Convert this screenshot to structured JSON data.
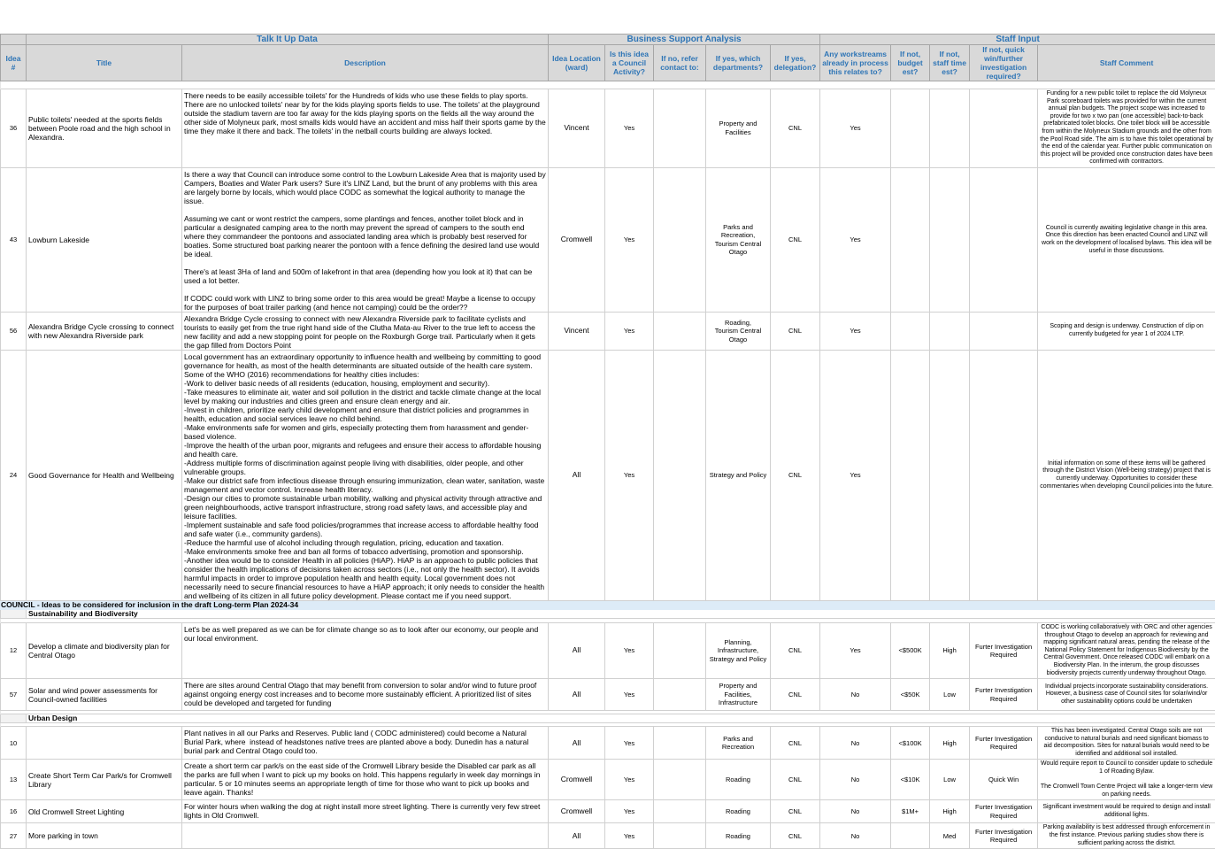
{
  "groups": {
    "talk": "Talk It Up Data",
    "business": "Business Support Analysis",
    "staff": "Staff Input"
  },
  "headers": {
    "idea": "Idea #",
    "title": "Title",
    "description": "Description",
    "location": "Idea Location (ward)",
    "council_activity": "Is this idea a Council Activity?",
    "refer": "If no, refer contact to:",
    "departments": "If yes, which departments?",
    "delegation": "If yes, delegation?",
    "workstreams": "Any workstreams already in process this relates to?",
    "budget": "If not, budget est?",
    "staff_time": "If not, staff time est?",
    "quick_win": "If not, quick win/further investigation required?",
    "comment": "Staff Comment"
  },
  "rows_a": [
    {
      "id": "36",
      "title": "Public toilets' needed at the sports fields between Poole road and the high school in Alexandra.",
      "desc": "There needs to be easily accessible toilets' for the Hundreds of kids who use these fields to play sports. There are no unlocked toilets' near by for the kids playing sports fields to use. The toilets' at the playground outside the stadium tavern are too far away for the kids playing sports on the fields all the way around the other side of Molyneux park, most smalls kids would have an accident and miss half their sports game by the time they make it there and back. The toilets' in the netball courts building are always locked.",
      "loc": "Vincent",
      "council": "Yes",
      "refer": "",
      "dept": "Property and Facilities",
      "deleg": "CNL",
      "work": "Yes",
      "budget": "",
      "time": "",
      "quick": "",
      "cmt": "Funding for a new public toilet to replace the old Molyneux Park scoreboard toilets was provided for within the current annual plan budgets. The project scope was increased to provide for two x two pan (one accessible) back-to-back prefabricated toilet blocks. One toilet block will be accessible from within the Molyneux Stadium grounds and the other from the Pool Road side. The aim is to have this toilet operational by the end of the calendar year. Further public communication on this project will be provided once construction dates have been confirmed with contractors."
    },
    {
      "id": "43",
      "title": "Lowburn Lakeside",
      "desc": "Is there a way that Council can introduce some control to the Lowburn Lakeside Area that is majority used by Campers, Boaties and Water Park users? Sure it's LINZ Land, but the brunt of any problems with this area are largely borne by locals, which would place CODC as somewhat the logical authority to manage the issue.\n\nAssuming we cant or wont restrict the campers, some plantings and fences, another toilet block and in particular a designated camping area to the north may prevent the spread of campers to the south end where they commandeer the pontoons and associated landing area which is probably best reserved for boaties. Some structured boat parking nearer the pontoon with a fence defining the desired land use would be ideal.\n\nThere's at least 3Ha of land and 500m of lakefront in that area (depending how you look at it) that can be used a lot better.\n\nIf CODC could work with LINZ to bring some order to this area would be great! Maybe a license to occupy for the purposes of boat trailer parking (and hence not camping) could be the order??",
      "loc": "Cromwell",
      "council": "Yes",
      "refer": "",
      "dept": "Parks and Recreation,\nTourism Central Otago",
      "deleg": "CNL",
      "work": "Yes",
      "budget": "",
      "time": "",
      "quick": "",
      "cmt": "Council is currently awaiting legislative change in this area. Once this direction has been enacted Council and LINZ will work on the development of localised bylaws. This idea will be useful in those discussions."
    },
    {
      "id": "56",
      "title": "Alexandra Bridge Cycle crossing to connect with new Alexandra Riverside park",
      "desc": "Alexandra Bridge Cycle crossing to connect with new Alexandra Riverside park to facilitate cyclists and tourists to easily get from the true right hand side of the Clutha Mata-au River to the true left to access the new facility and add a new stopping point for people on the Roxburgh Gorge trail. Particularly when it gets the gap filled from Doctors Point",
      "loc": "Vincent",
      "council": "Yes",
      "refer": "",
      "dept": "Roading,\nTourism Central Otago",
      "deleg": "CNL",
      "work": "Yes",
      "budget": "",
      "time": "",
      "quick": "",
      "cmt": "Scoping and design is underway. Construction of clip on currently budgeted for year 1 of 2024 LTP."
    },
    {
      "id": "24",
      "title": "Good Governance for Health and Wellbeing",
      "desc": "Local government has an extraordinary opportunity to influence health and wellbeing by committing to good governance for health, as most of the health determinants are situated outside of the health care system. Some of the WHO (2016) recommendations for healthy cities includes:\n-Work to deliver basic needs of all residents (education, housing, employment and security).\n-Take measures to eliminate air, water and soil pollution in the district and tackle climate change at the local level by making our industries and cities green and ensure clean energy and air.\n-Invest in children, prioritize early child development and ensure that district policies and programmes in health, education and social services leave no child behind.\n-Make environments safe for women and girls, especially protecting them from harassment and gender-based violence.\n-Improve the health of the urban poor, migrants and refugees and ensure their access to affordable housing and health care.\n-Address multiple forms of discrimination against people living with disabilities, older people, and other vulnerable groups.\n-Make our district safe from infectious disease through ensuring immunization, clean water, sanitation, waste management and vector control. Increase health literacy.\n-Design our cities to promote sustainable urban mobility, walking and physical activity through attractive and green neighbourhoods, active transport infrastructure, strong road safety laws, and accessible play and leisure facilities.\n-Implement sustainable and safe food policies/programmes that increase access to affordable healthy food and safe water (i.e., community gardens).\n-Reduce the harmful use of alcohol including through regulation, pricing, education and taxation.\n-Make environments smoke free and ban all forms of tobacco advertising, promotion and sponsorship.\n-Another idea would be to consider Health in all policies (HiAP). HiAP is an approach to public policies that consider the health implications of decisions taken across sectors (i.e., not only the health sector). It avoids harmful impacts in order to improve population health and health equity. Local government does not necessarily need to secure financial resources to have a HiAP approach; it only needs to consider the health and wellbeing of its citizen in all future policy development. Please contact me if you need support.",
      "loc": "All",
      "council": "Yes",
      "refer": "",
      "dept": "Strategy and Policy",
      "deleg": "CNL",
      "work": "Yes",
      "budget": "",
      "time": "",
      "quick": "",
      "cmt": "Initial information on some of these items will be gathered through the District Vision (Well-being strategy) project that is currently underway. Opportunities to consider these commentaries when developing Council policies into the future."
    }
  ],
  "section_title": "COUNCIL - Ideas to be considered for inclusion in the draft Long-term Plan 2024-34",
  "sub_sustainability": "Sustainability and Biodiversity",
  "rows_b": [
    {
      "id": "12",
      "title": "Develop a climate and biodiversity plan for Central Otago",
      "desc": "Let's be as well prepared as we can be for climate change so as to look after our economy, our people and our local environment.",
      "loc": "All",
      "council": "Yes",
      "refer": "",
      "dept": "Planning,\nInfrastructure,\nStrategy and Policy",
      "deleg": "CNL",
      "work": "Yes",
      "budget": "<$500K",
      "time": "High",
      "quick": "Furter Investigation Required",
      "cmt": "CODC is working collaboratively with ORC and other agencies throughout Otago to develop an approach for reviewing and mapping significant natural areas, pending the release of the National Policy Statement for Indigenous Biodiversity by the Central Government. Once released CODC will embark on a Biodiversity Plan.  In the interum, the group discusses biodiversity projects currently underway throughout Otago."
    },
    {
      "id": "57",
      "title": "Solar and wind power assessments for Council-owned facilities",
      "desc": "There are sites around Central Otago that may benefit from conversion to solar and/or wind to future proof against ongoing energy cost increases and to become more sustainably efficient. A prioritized list of sites could be developed and targeted for funding",
      "loc": "All",
      "council": "Yes",
      "refer": "",
      "dept": "Property and Facilities,\nInfrastructure",
      "deleg": "CNL",
      "work": "No",
      "budget": "<$50K",
      "time": "Low",
      "quick": "Furter Investigation Required",
      "cmt": "Individual projects incorporate sustainability considerations. However, a business case of Council sites for solar/wind/or other sustainability options could be undertaken"
    }
  ],
  "sub_urban": "Urban Design",
  "rows_c": [
    {
      "id": "10",
      "title": "",
      "desc": "Plant natives in all our Parks and Reserves. Public land ( CODC administered) could become a Natural Burial Park, where  instead of headstones native trees are planted above a body. Dunedin has a natural burial park and Central Otago could too.",
      "loc": "All",
      "council": "Yes",
      "refer": "",
      "dept": "Parks and Recreation",
      "deleg": "CNL",
      "work": "No",
      "budget": "<$100K",
      "time": "High",
      "quick": "Furter Investigation Required",
      "cmt": "This has been investigated. Central Otago soils are not conducive to natural burials and need significant biomass to aid decomposition. Sites for natural burials would need to be identified and additional soil installed."
    },
    {
      "id": "13",
      "title": "Create Short Term Car Park/s for Cromwell Library",
      "desc": "Create a short term car park/s on the east side of the Cromwell Library beside the Disabled car park as all the parks are full when I want to pick up my books on hold. This happens regularly in week day mornings in particular. 5 or 10 minutes seems an appropriate length of time for those who want to pick up books and leave again. Thanks!",
      "loc": "Cromwell",
      "council": "Yes",
      "refer": "",
      "dept": "Roading",
      "deleg": "CNL",
      "work": "No",
      "budget": "<$10K",
      "time": "Low",
      "quick": "Quick Win",
      "cmt": "Would require report to Council to consider update to schedule 1 of Roading Bylaw.\n\nThe Cromwell Town Centre Project will take a longer-term view on parking needs."
    },
    {
      "id": "16",
      "title": "Old Cromwell Street Lighting",
      "desc": "For winter hours when walking the dog at night install more street lighting. There is currently very few street lights in Old Cromwell.",
      "loc": "Cromwell",
      "council": "Yes",
      "refer": "",
      "dept": "Roading",
      "deleg": "CNL",
      "work": "No",
      "budget": "$1M+",
      "time": "High",
      "quick": "Furter Investigation Required",
      "cmt": "Significant investment would be required to design and install additional lights."
    },
    {
      "id": "27",
      "title": "More parking in town",
      "desc": "",
      "loc": "All",
      "council": "Yes",
      "refer": "",
      "dept": "Roading",
      "deleg": "CNL",
      "work": "No",
      "budget": "",
      "time": "Med",
      "quick": "Furter Investigation Required",
      "cmt": "Parking availability is best addressed through enforcement in the first instance. Previous parking studies show there is sufficient parking across the district."
    }
  ]
}
